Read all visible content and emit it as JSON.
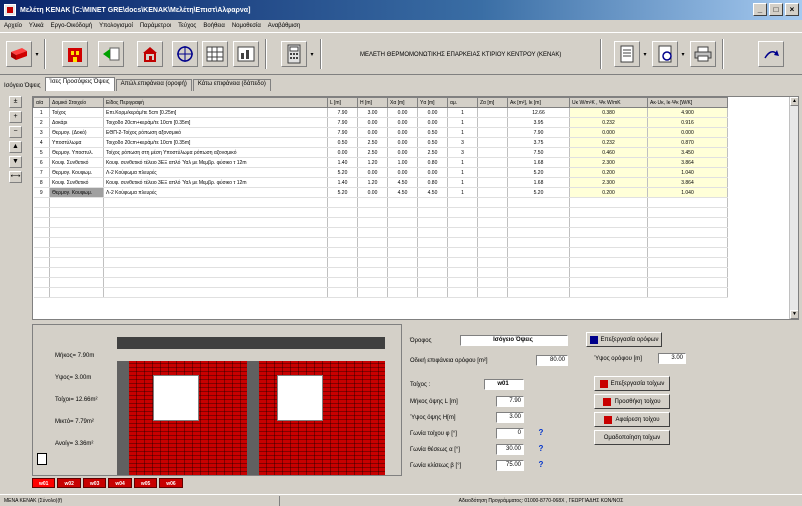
{
  "window": {
    "title": "Μελέτη ΚΕΝΑΚ [C:\\ΜΙΝΕΤ GRE\\docs\\ΚΕΝΑΚ\\Μελέτη\\Επιστ\\Αλφαρνα]",
    "min": "_",
    "max": "□",
    "close": "×"
  },
  "menu": [
    "Αρχείο",
    "Υλικά",
    "Εργο-Οικόδομή",
    "Υπολογισμοί",
    "Παράμετροι",
    "Τεύχος",
    "Βοήθεια",
    "Νομοθεσία",
    "Αναβάθμιση"
  ],
  "toolbar": {
    "study_title": "ΜΕΛΕΤΗ ΘΕΡΜΟΜΟΝΩΤΙΚΗΣ ΕΠΑΡΚΕΙΑΣ ΚΤΙΡΙΟΥ ΚΕΝΤΡΟΥ (ΚΕΝΑΚ)",
    "drop": "▾"
  },
  "tabs": {
    "label": "Ισόγειο Όψεις",
    "items": [
      "Ίσες Προσόψεις Όψεις",
      "Απώλ.επιφάνεια (οροφή)",
      "Κάτω επιφάνεια (δάπεδο)"
    ]
  },
  "side_buttons": [
    "±",
    "+",
    "−",
    "▲",
    "▼",
    "⟷"
  ],
  "table": {
    "headers": [
      "α/α",
      "Δομικό Στοιχείο",
      "Είδος Περιγραφή",
      "L [m]",
      "H [m]",
      "Xα [m]",
      "Yα [m]",
      "αμ.",
      "Zα [m]",
      "Aκ [m²], Ικ [m]",
      "Uκ W/m²K , Ψκ W/mK",
      "Aκ·Uκ, Ικ·Ψκ [W/K]"
    ],
    "rows": [
      [
        "1",
        "Τοίχος",
        "Επι.Κορμ/κεράμ/τε 5cm [0.25m]",
        "7.90",
        "3.00",
        "0.00",
        "0.00",
        "1",
        "",
        "12.66",
        "0.380",
        "4.900"
      ],
      [
        "2",
        "Δοκάρι",
        "Τοιχοδο 20cm+κεράμ/τε 10cm [0.35m]",
        "7.90",
        "0.00",
        "0.00",
        "0.00",
        "1",
        "",
        "3.95",
        "0.232",
        "0.916"
      ],
      [
        "3",
        "Θερμογ. (Δοκό)",
        "ΕΘΠ-2-Τοίχος ρόπωση αξονσμικό",
        "7.90",
        "0.00",
        "0.00",
        "0.50",
        "1",
        "",
        "7.90",
        "0.000",
        "0.000"
      ],
      [
        "4",
        "Υποστύλωμα",
        "Τοιχοδο 20cm+κεράμ/τε 10cm [0.35m]",
        "0.50",
        "2.50",
        "0.00",
        "0.50",
        "3",
        "",
        "3.75",
        "0.232",
        "0.870"
      ],
      [
        "5",
        "Θερμογ. Υποστυλ.",
        "Τοίχος ρόπωση στη μέση Υποστύλωμα ρόπωση αξονσμικό",
        "0.00",
        "2.50",
        "0.00",
        "2.50",
        "3",
        "",
        "7.50",
        "0.460",
        "3.450"
      ],
      [
        "6",
        "Κουφ. Συνθετικό",
        "Κουφ. συνθετικό τέλειο 3ΕΞ απλό Ύαλ με Μεμβρ. φύσικο τ 12m",
        "1.40",
        "1.20",
        "1.00",
        "0.80",
        "1",
        "",
        "1.68",
        "2.300",
        "3.864"
      ],
      [
        "7",
        "Θερμογ. Κουφωμ.",
        "Λ-2 Κούφωμα πλευρές",
        "5.20",
        "0.00",
        "0.00",
        "0.00",
        "1",
        "",
        "5.20",
        "0.200",
        "1.040"
      ],
      [
        "8",
        "Κουφ. Συνθετικό",
        "Κουφ. συνθετικό τέλειο 3ΕΞ απλό Ύαλ με Μεμβρ. φύσικο τ 12m",
        "1.40",
        "1.20",
        "4.50",
        "0.80",
        "1",
        "",
        "1.68",
        "2.300",
        "3.864"
      ],
      [
        "9",
        "Θερμογ. Κουφωμ.",
        "Λ-2 Κούφωμα πλευρές",
        "5.20",
        "0.00",
        "4.50",
        "4.50",
        "1",
        "",
        "5.20",
        "0.200",
        "1.040"
      ]
    ]
  },
  "metrics": {
    "m1": "Μήκος=  7.90m",
    "m2": "Υψος=  3.00m",
    "m3": "Τοίχοι=  12.66m²",
    "m4": "Μικτό=  7.79m²",
    "m5": "Ανοίγ=  3.36m²"
  },
  "form": {
    "floor_label": "Όροφος",
    "floor_value": "Ισόγειο  Όψεις",
    "area_label": "Οδική επιφάνεια ορόφου [m²]",
    "area_value": "80.00",
    "height_label": "Ύψος ορόφου [m]",
    "height_value": "3.00",
    "wall_label": "Τοίχος :",
    "wall_value": "w01",
    "length_label": "Μήκος όψης L [m]",
    "length_value": "7.90",
    "h_label": "Ύψος όψης H[m]",
    "h_value": "3.00",
    "phi_label": "Γωνία τοίχου φ [°]",
    "phi_value": "0",
    "alpha_label": "Γωνία θέσεως α [°]",
    "alpha_value": "30.00",
    "beta_label": "Γωνία κλίσεως β [°]",
    "beta_value": "75.00",
    "help": "?"
  },
  "actions": {
    "floors": "Επεξεργασία ορόφων",
    "edit_walls": "Επεξεργασία τοίχων",
    "add_wall": "Προσθήκη τοίχου",
    "delete_wall": "Αφαίρεση τοίχου",
    "wall_order": "Ομαδοποίηση τοίχων"
  },
  "wall_tabs": [
    "w01",
    "w02",
    "w03",
    "w04",
    "w05",
    "w06"
  ],
  "status": {
    "left": "ΜΕΝΑ ΚΕΝΑΚ (Σύνολο)(f)",
    "center": "Αδειοδότηση Προγράμματος: 01000-8770-068Χ , ΓΕΩΡΓΙΑΔΗΣ ΚΩΝ/ΝΟΣ"
  },
  "colors": {
    "accent": "#0a246a",
    "brick": "#c80000",
    "highlight": "#ffffd8"
  }
}
